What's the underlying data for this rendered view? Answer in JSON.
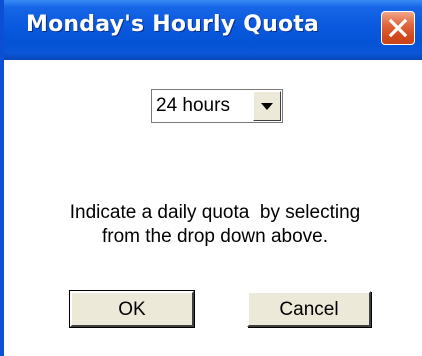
{
  "window": {
    "title": "Monday's Hourly Quota"
  },
  "quota_select": {
    "selected_value": "24 hours"
  },
  "instructions": {
    "line1": "Indicate a daily quota  by selecting",
    "line2": "from the drop down above."
  },
  "buttons": {
    "ok_label": "OK",
    "cancel_label": "Cancel"
  },
  "icons": {
    "close": "close-icon",
    "dropdown": "chevron-down-icon"
  },
  "colors": {
    "titlebar": "#0a58de",
    "close_button": "#d2491c",
    "button_face": "#ece9d8"
  }
}
